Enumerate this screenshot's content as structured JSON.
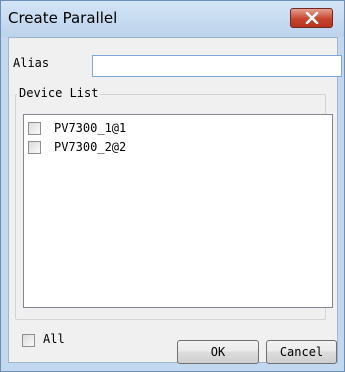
{
  "window": {
    "title": "Create Parallel",
    "close_icon": "close-x-icon"
  },
  "form": {
    "alias_label": "Alias",
    "alias_value": "",
    "alias_placeholder": ""
  },
  "device_list": {
    "group_label": "Device List",
    "items": [
      {
        "label": "PV7300_1@1",
        "checked": false
      },
      {
        "label": "PV7300_2@2",
        "checked": false
      }
    ]
  },
  "footer": {
    "all_label": "All",
    "all_checked": false,
    "ok_label": "OK",
    "cancel_label": "Cancel"
  }
}
